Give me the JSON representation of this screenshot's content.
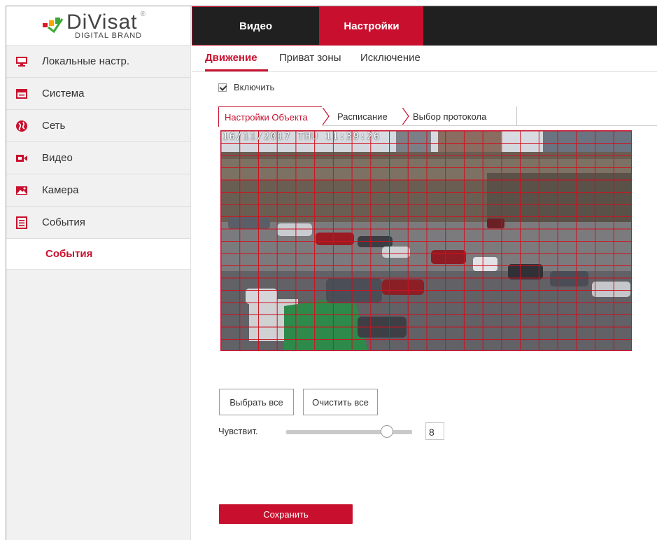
{
  "brand": {
    "name": "DiVisat",
    "registered": "®",
    "tagline": "DIGITAL BRAND"
  },
  "topbar": {
    "video_label": "Видео",
    "settings_label": "Настройки"
  },
  "sidebar": {
    "items": [
      {
        "label": "Локальные настр.",
        "icon": "monitor-icon"
      },
      {
        "label": "Система",
        "icon": "system-window-icon"
      },
      {
        "label": "Сеть",
        "icon": "globe-icon"
      },
      {
        "label": "Видео",
        "icon": "video-camera-icon"
      },
      {
        "label": "Камера",
        "icon": "image-icon"
      },
      {
        "label": "События",
        "icon": "events-list-icon"
      }
    ],
    "active_sub": "События"
  },
  "subtabs": {
    "motion": "Движение",
    "privacy": "Приват зоны",
    "exception": "Исключение"
  },
  "enable": {
    "label": "Включить",
    "checked": true
  },
  "steps": {
    "object": "Настройки Объекта",
    "schedule": "Расписание",
    "protocol": "Выбор протокола"
  },
  "video": {
    "osd": "16/11/2017 THU 11:39:26",
    "grid_cols": 22,
    "grid_rows": 18
  },
  "buttons": {
    "select_all": "Выбрать все",
    "clear_all": "Очистить все",
    "save": "Сохранить"
  },
  "sensitivity": {
    "label": "Чувствит.",
    "value": "8",
    "fraction": 0.8
  },
  "colors": {
    "accent": "#c8102e",
    "topbar": "#202020",
    "sidebar": "#f1f1f1"
  }
}
